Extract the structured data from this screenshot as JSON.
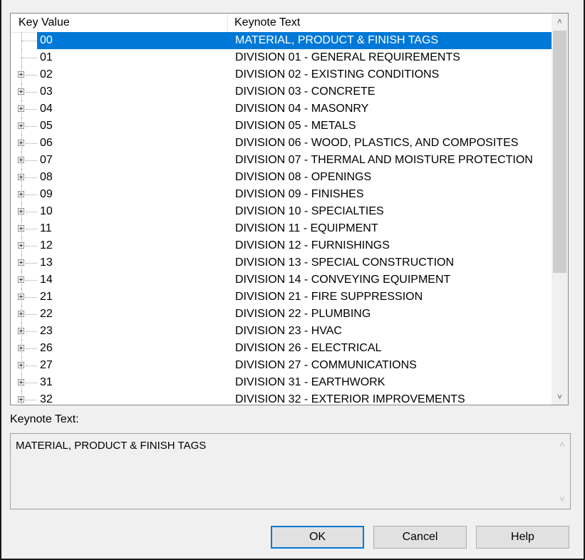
{
  "columns": {
    "key": "Key Value",
    "text": "Keynote Text"
  },
  "rows": [
    {
      "key": "00",
      "text": "MATERIAL, PRODUCT & FINISH TAGS",
      "expandable": false,
      "selected": true
    },
    {
      "key": "01",
      "text": "DIVISION 01 - GENERAL REQUIREMENTS",
      "expandable": false,
      "selected": false
    },
    {
      "key": "02",
      "text": "DIVISION 02 - EXISTING CONDITIONS",
      "expandable": true,
      "selected": false
    },
    {
      "key": "03",
      "text": "DIVISION 03 - CONCRETE",
      "expandable": true,
      "selected": false
    },
    {
      "key": "04",
      "text": "DIVISION 04 - MASONRY",
      "expandable": true,
      "selected": false
    },
    {
      "key": "05",
      "text": "DIVISION 05 - METALS",
      "expandable": true,
      "selected": false
    },
    {
      "key": "06",
      "text": "DIVISION 06 - WOOD, PLASTICS, AND COMPOSITES",
      "expandable": true,
      "selected": false
    },
    {
      "key": "07",
      "text": "DIVISION 07 - THERMAL AND MOISTURE PROTECTION",
      "expandable": true,
      "selected": false
    },
    {
      "key": "08",
      "text": "DIVISION 08 - OPENINGS",
      "expandable": true,
      "selected": false
    },
    {
      "key": "09",
      "text": "DIVISION 09 - FINISHES",
      "expandable": true,
      "selected": false
    },
    {
      "key": "10",
      "text": "DIVISION 10 - SPECIALTIES",
      "expandable": true,
      "selected": false
    },
    {
      "key": "11",
      "text": "DIVISION 11 - EQUIPMENT",
      "expandable": true,
      "selected": false
    },
    {
      "key": "12",
      "text": "DIVISION 12 - FURNISHINGS",
      "expandable": true,
      "selected": false
    },
    {
      "key": "13",
      "text": "DIVISION 13 - SPECIAL CONSTRUCTION",
      "expandable": true,
      "selected": false
    },
    {
      "key": "14",
      "text": "DIVISION 14 - CONVEYING EQUIPMENT",
      "expandable": true,
      "selected": false
    },
    {
      "key": "21",
      "text": "DIVISION 21 - FIRE SUPPRESSION",
      "expandable": true,
      "selected": false
    },
    {
      "key": "22",
      "text": "DIVISION 22 - PLUMBING",
      "expandable": true,
      "selected": false
    },
    {
      "key": "23",
      "text": "DIVISION 23 - HVAC",
      "expandable": true,
      "selected": false
    },
    {
      "key": "26",
      "text": "DIVISION 26 - ELECTRICAL",
      "expandable": true,
      "selected": false
    },
    {
      "key": "27",
      "text": "DIVISION 27 - COMMUNICATIONS",
      "expandable": true,
      "selected": false
    },
    {
      "key": "31",
      "text": "DIVISION 31 - EARTHWORK",
      "expandable": true,
      "selected": false
    },
    {
      "key": "32",
      "text": "DIVISION 32 - EXTERIOR IMPROVEMENTS",
      "expandable": true,
      "selected": false
    }
  ],
  "scrollbar": {
    "up_icon": "chevron-up-icon",
    "down_icon": "chevron-down-icon"
  },
  "details": {
    "label": "Keynote Text:",
    "value": "MATERIAL, PRODUCT & FINISH TAGS"
  },
  "buttons": {
    "ok": "OK",
    "cancel": "Cancel",
    "help": "Help"
  },
  "colors": {
    "selection": "#0078d7",
    "default_button_border": "#0078d7"
  }
}
